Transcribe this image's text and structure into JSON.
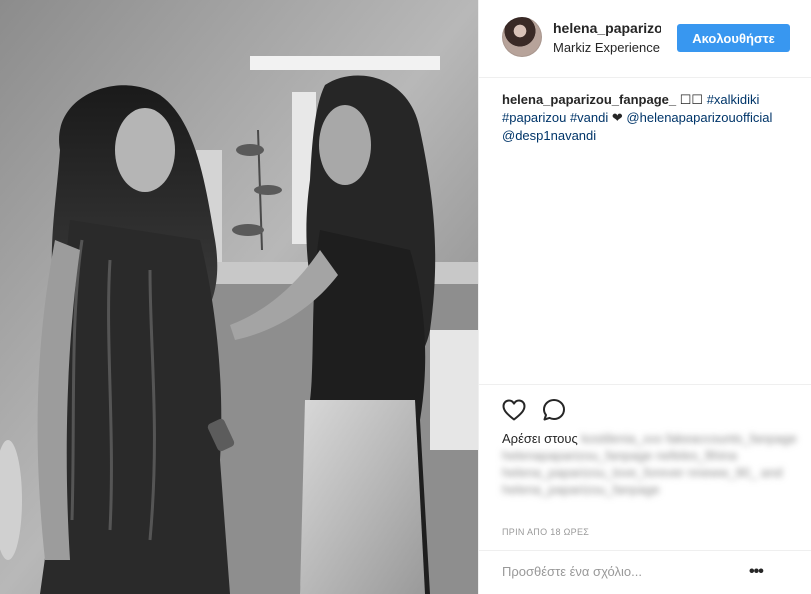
{
  "post": {
    "header": {
      "username": "helena_paparizou",
      "location": "Markiz Experience",
      "follow_label": "Ακολουθήστε"
    },
    "caption": {
      "author": "helena_paparizou_fanpage_",
      "emoji": "☐☐",
      "parts": {
        "hashtag_1": "#xalkidiki",
        "hashtag_2": "#paparizou",
        "hashtag_3": "#vandi",
        "heart": "❤",
        "mention_1": "@helenapaparizouofficial",
        "mention_2": "@desp1navandi"
      }
    },
    "likes": {
      "prefix": "Αρέσει στους",
      "blurred_names": "kostilenia_xxx fakeaccounts_fanpage helenapaparizou_fanpage nefeles_fthina helena_paparizou_love_forever nneww_90_ and helena_paparizou_fanpage"
    },
    "timestamp": "ΠΡΙΝ ΑΠΟ 18 ΩΡΕΣ",
    "comment": {
      "placeholder": "Προσθέστε ένα σχόλιο...",
      "more_label": "•••"
    },
    "icons": {
      "like": "heart-outline-icon",
      "comment": "speech-bubble-icon"
    },
    "colors": {
      "follow_button": "#3897f0",
      "hashtag": "#003569",
      "meta_text": "#999999"
    }
  }
}
